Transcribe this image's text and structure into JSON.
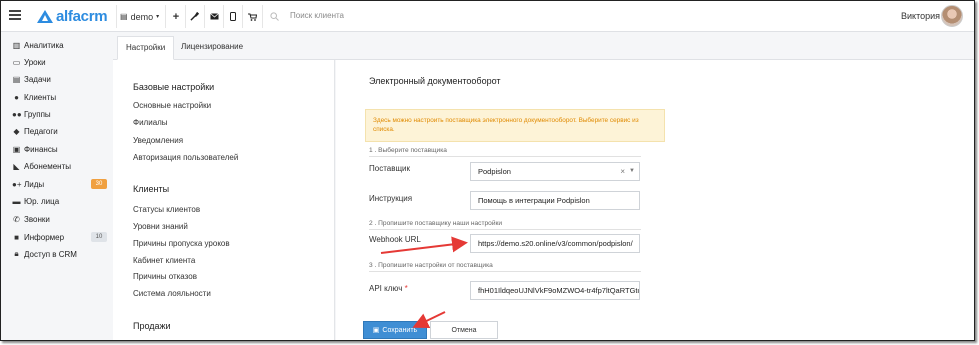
{
  "header": {
    "logo_text": "alfacrm",
    "branch_label": "demo",
    "add_icon": "plus-icon",
    "tools_icon": "wrench-icon",
    "mail_icon": "mail-icon",
    "phone_icon": "phone-icon",
    "cart_icon": "cart-icon",
    "search_placeholder": "Поиск клиента",
    "user_name": "Виктория"
  },
  "sidebar": {
    "items": [
      {
        "label": "Аналитика",
        "icon": "analytics-icon"
      },
      {
        "label": "Уроки",
        "icon": "calendar-icon"
      },
      {
        "label": "Задачи",
        "icon": "tasks-icon"
      },
      {
        "label": "Клиенты",
        "icon": "user-icon"
      },
      {
        "label": "Группы",
        "icon": "group-icon"
      },
      {
        "label": "Педагоги",
        "icon": "graduation-cap-icon"
      },
      {
        "label": "Финансы",
        "icon": "money-icon"
      },
      {
        "label": "Абонементы",
        "icon": "tag-icon"
      },
      {
        "label": "Лиды",
        "icon": "lead-icon",
        "badge": "30"
      },
      {
        "label": "Юр. лица",
        "icon": "briefcase-icon"
      },
      {
        "label": "Звонки",
        "icon": "phone-icon"
      },
      {
        "label": "Информер",
        "icon": "informer-icon",
        "badge": "10"
      },
      {
        "label": "Доступ в CRM",
        "icon": "lock-icon"
      }
    ]
  },
  "tabs": [
    "Настройки",
    "Лицензирование"
  ],
  "settings_menu": {
    "sections": [
      {
        "title": "Базовые настройки",
        "links": [
          "Основные настройки",
          "Филиалы",
          "Уведомления",
          "Авторизация пользователей"
        ]
      },
      {
        "title": "Клиенты",
        "links": [
          "Статусы клиентов",
          "Уровни знаний",
          "Причины пропуска уроков",
          "Кабинет клиента",
          "Причины отказов",
          "Система лояльности"
        ]
      },
      {
        "title": "Продажи",
        "links": []
      }
    ]
  },
  "form": {
    "title": "Электронный документооборот",
    "notice": "Здесь можно настроить поставщика электронного документооборот. Выберите сервис из списка.",
    "step1": "1 . Выберите поставщика",
    "provider_label": "Поставщик",
    "provider_value": "Podpislon",
    "instruction_label": "Инструкция",
    "instruction_value": "Помощь в интеграции Podpislon",
    "step2": "2 . Пропишите поставщику наши настройки",
    "webhook_label": "Webhook URL",
    "webhook_value": "https://demo.s20.online/v3/common/podpislon/",
    "step3": "3 . Пропишите настройки от поставщика",
    "api_label": "API ключ",
    "api_required": "*",
    "api_value": "fhH01IldqeoUJNlVkF9oMZWO4-tr4fp7ltQaRTGtc",
    "save_label": "Сохранить",
    "cancel_label": "Отмена"
  },
  "colors": {
    "brand": "#2d8ce0",
    "save_button": "#3f8ed4",
    "notice_bg": "#fdf3d7",
    "notice_text": "#e08a00",
    "annotation_arrow": "#e53935"
  }
}
